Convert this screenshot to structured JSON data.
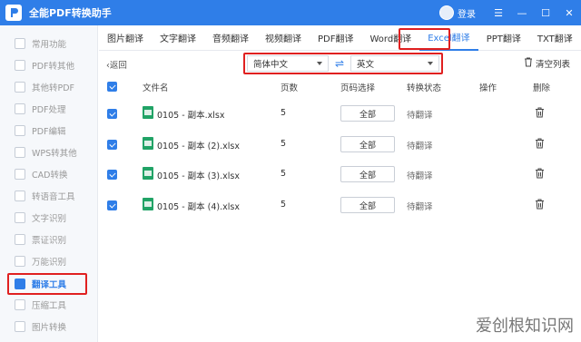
{
  "app": {
    "title": "全能PDF转换助手",
    "login": "登录"
  },
  "sidebar": {
    "items": [
      {
        "label": "常用功能"
      },
      {
        "label": "PDF转其他"
      },
      {
        "label": "其他转PDF"
      },
      {
        "label": "PDF处理"
      },
      {
        "label": "PDF编辑"
      },
      {
        "label": "WPS转其他"
      },
      {
        "label": "CAD转换"
      },
      {
        "label": "转语音工具"
      },
      {
        "label": "文字识别"
      },
      {
        "label": "票证识别"
      },
      {
        "label": "万能识别"
      },
      {
        "label": "翻译工具",
        "active": true
      },
      {
        "label": "压缩工具"
      },
      {
        "label": "图片转换"
      }
    ]
  },
  "tabs": [
    {
      "label": "图片翻译"
    },
    {
      "label": "文字翻译"
    },
    {
      "label": "音频翻译"
    },
    {
      "label": "视频翻译"
    },
    {
      "label": "PDF翻译"
    },
    {
      "label": "Word翻译"
    },
    {
      "label": "Excel翻译",
      "active": true
    },
    {
      "label": "PPT翻译"
    },
    {
      "label": "TXT翻译"
    }
  ],
  "toolbar": {
    "back": "返回",
    "source_lang": "简体中文",
    "target_lang": "英文",
    "clear_list": "清空列表"
  },
  "table": {
    "headers": {
      "filename": "文件名",
      "pages": "页数",
      "page_select": "页码选择",
      "status": "转换状态",
      "action": "操作",
      "delete": "删除"
    },
    "rows": [
      {
        "filename": "0105 - 副本.xlsx",
        "pages": "5",
        "page_select": "全部",
        "status": "待翻译"
      },
      {
        "filename": "0105 - 副本 (2).xlsx",
        "pages": "5",
        "page_select": "全部",
        "status": "待翻译"
      },
      {
        "filename": "0105 - 副本 (3).xlsx",
        "pages": "5",
        "page_select": "全部",
        "status": "待翻译"
      },
      {
        "filename": "0105 - 副本 (4).xlsx",
        "pages": "5",
        "page_select": "全部",
        "status": "待翻译"
      }
    ]
  },
  "watermark": "爱创根知识网",
  "colors": {
    "accent": "#2f7ee8",
    "highlight": "#e02020",
    "excel": "#21a366"
  }
}
